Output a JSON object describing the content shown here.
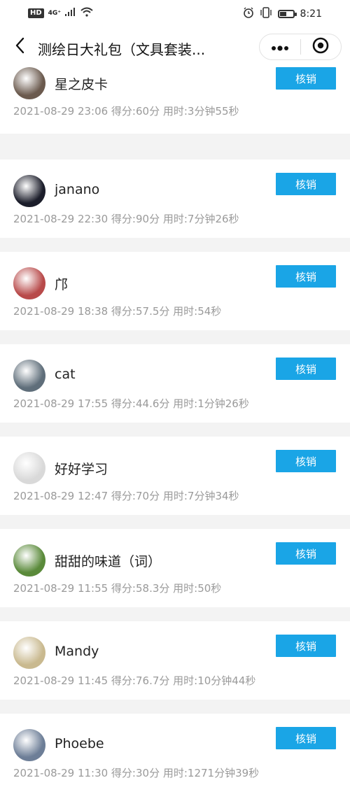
{
  "status_bar": {
    "left_badges": [
      "HD",
      "4G⁺"
    ],
    "time": "8:21",
    "battery_level": 0.5
  },
  "nav": {
    "title": "测绘日大礼包（文具套装..."
  },
  "button_label": "核销",
  "records": [
    {
      "name": "星之皮卡",
      "meta": "2021-08-29 23:06 得分:60分 用时:3分钟55秒",
      "avatar_color": "#6b5a4e"
    },
    {
      "name": "janano",
      "meta": "2021-08-29 22:30 得分:90分 用时:7分钟26秒",
      "avatar_color": "#1b1d2a"
    },
    {
      "name": "邝",
      "meta": "2021-08-29 18:38 得分:57.5分 用时:54秒",
      "avatar_color": "#b84a4a"
    },
    {
      "name": "cat",
      "meta": "2021-08-29 17:55 得分:44.6分 用时:1分钟26秒",
      "avatar_color": "#5f6e7a"
    },
    {
      "name": "好好学习",
      "meta": "2021-08-29 12:47 得分:70分 用时:7分钟34秒",
      "avatar_color": "#d9d9d9"
    },
    {
      "name": "甜甜的味道（词）",
      "meta": "2021-08-29 11:55 得分:58.3分 用时:50秒",
      "avatar_color": "#5a8a3a"
    },
    {
      "name": "Mandy",
      "meta": "2021-08-29 11:45 得分:76.7分 用时:10分钟44秒",
      "avatar_color": "#c9b98f"
    },
    {
      "name": "Phoebe",
      "meta": "2021-08-29 11:30 得分:30分 用时:1271分钟39秒",
      "avatar_color": "#6d7e97"
    }
  ],
  "icons": {
    "back": "chevron-left-icon",
    "more": "more-dots-icon",
    "close": "target-circle-icon",
    "alarm": "alarm-icon",
    "vibrate": "vibrate-icon",
    "wifi": "wifi-icon",
    "signal": "signal-icon",
    "battery": "battery-icon"
  }
}
